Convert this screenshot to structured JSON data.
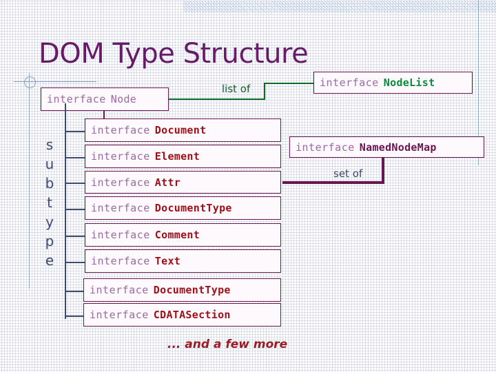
{
  "slide": {
    "title": "DOM Type Structure",
    "footnote": "... and a few more",
    "subtype_label": "subtype",
    "subtype_letters": [
      "s",
      "u",
      "b",
      "t",
      "y",
      "p",
      "e"
    ],
    "keyword": "interface",
    "colors": {
      "title": "#671b67",
      "box_border": "#6b1550",
      "box_fill": "#fdf9fd",
      "keyword": "#9a6aa0",
      "name_red": "#9e0f18",
      "name_green": "#0a8a3a",
      "name_purple": "#6b1550",
      "tree_line": "#3e4a6b",
      "list_of_edge": "#0d6b22",
      "set_of_edge": "#6b1550",
      "guide": "#8ea3bc"
    }
  },
  "root_box": {
    "keyword": "interface",
    "name": "Node",
    "name_color": "plain"
  },
  "edges": [
    {
      "id": "list-of",
      "label": "list of",
      "color": "green",
      "from": "Node",
      "to": "NodeList"
    },
    {
      "id": "set-of",
      "label": "set of",
      "color": "purple",
      "from": "Attr",
      "to": "NamedNodeMap"
    }
  ],
  "right_boxes": [
    {
      "keyword": "interface",
      "name": "NodeList",
      "name_color": "green"
    },
    {
      "keyword": "interface",
      "name": "NamedNodeMap",
      "name_color": "purple"
    }
  ],
  "subtype_boxes": [
    {
      "keyword": "interface",
      "name": "Document",
      "name_color": "red"
    },
    {
      "keyword": "interface",
      "name": "Element",
      "name_color": "red"
    },
    {
      "keyword": "interface",
      "name": "Attr",
      "name_color": "red"
    },
    {
      "keyword": "interface",
      "name": "DocumentType",
      "name_color": "red"
    },
    {
      "keyword": "interface",
      "name": "Comment",
      "name_color": "red"
    },
    {
      "keyword": "interface",
      "name": "Text",
      "name_color": "red"
    },
    {
      "keyword": "interface",
      "name": "DocumentType",
      "name_color": "red"
    },
    {
      "keyword": "interface",
      "name": "CDATASection",
      "name_color": "red"
    }
  ]
}
